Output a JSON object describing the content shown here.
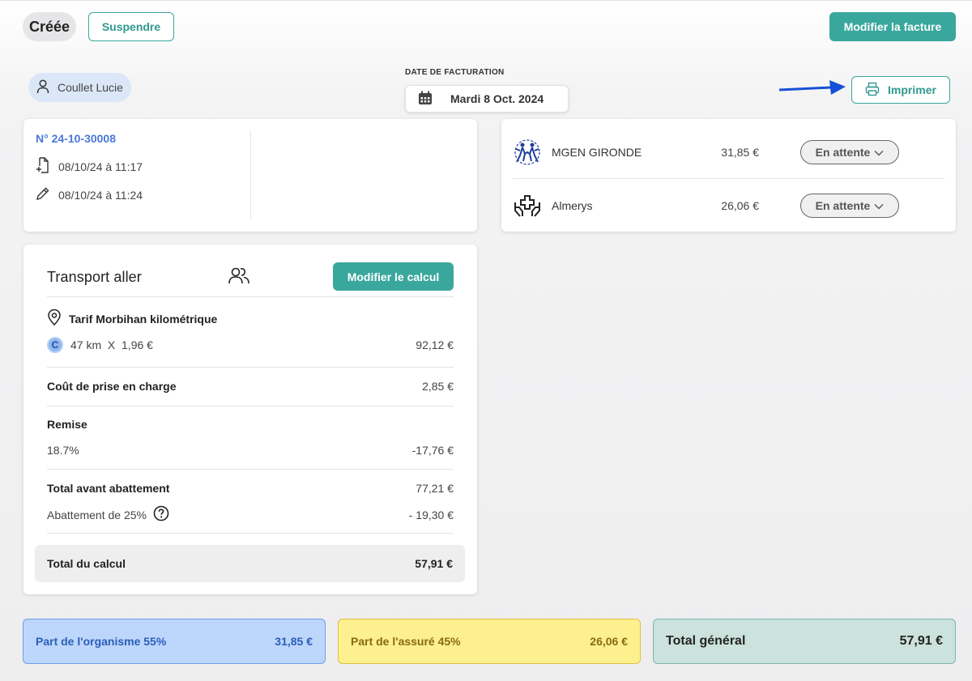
{
  "header": {
    "status": "Créée",
    "suspend_label": "Suspendre",
    "modify_invoice_label": "Modifier la facture",
    "patient_name": "Coullet Lucie",
    "date_label": "DATE DE FACTURATION",
    "date_value": "Mardi 8 Oct. 2024",
    "print_label": "Imprimer"
  },
  "invoice": {
    "number": "N° 24-10-30008",
    "created": "08/10/24 à 11:17",
    "modified": "08/10/24 à 11:24"
  },
  "payers": [
    {
      "name": "MGEN GIRONDE",
      "amount": "31,85 €",
      "status": "En attente",
      "logo": "mgen-logo-icon"
    },
    {
      "name": "Almerys",
      "amount": "26,06 €",
      "status": "En attente",
      "logo": "almerys-hands-icon"
    }
  ],
  "transport": {
    "title": "Transport aller",
    "modify_calc_label": "Modifier le calcul",
    "tariff": "Tarif Morbihan kilométrique",
    "c_badge": "C",
    "distance_calc": "47 km  X  1,96 €",
    "distance_amount": "92,12 €",
    "pickup_label": "Coût de prise en charge",
    "pickup_amount": "2,85 €",
    "discount_label": "Remise",
    "discount_pct": "18.7%",
    "discount_amount": "-17,76 €",
    "pre_abatement_label": "Total avant abattement",
    "pre_abatement_amount": "77,21 €",
    "abatement_label": "Abattement de 25%",
    "abatement_amount": "- 19,30 €",
    "total_label": "Total du calcul",
    "total_amount": "57,91 €"
  },
  "totals": {
    "org_label": "Part de l'organisme 55%",
    "org_amount": "31,85 €",
    "insured_label": "Part de l'assuré 45%",
    "insured_amount": "26,06 €",
    "grand_label": "Total général",
    "grand_amount": "57,91 €"
  },
  "colors": {
    "accent": "#3aa79d",
    "link_blue": "#4a78d8",
    "org_bg": "#bdd6fb",
    "insured_bg": "#fdf08e",
    "total_bg": "#cce2dc",
    "arrow": "#1550d6"
  }
}
